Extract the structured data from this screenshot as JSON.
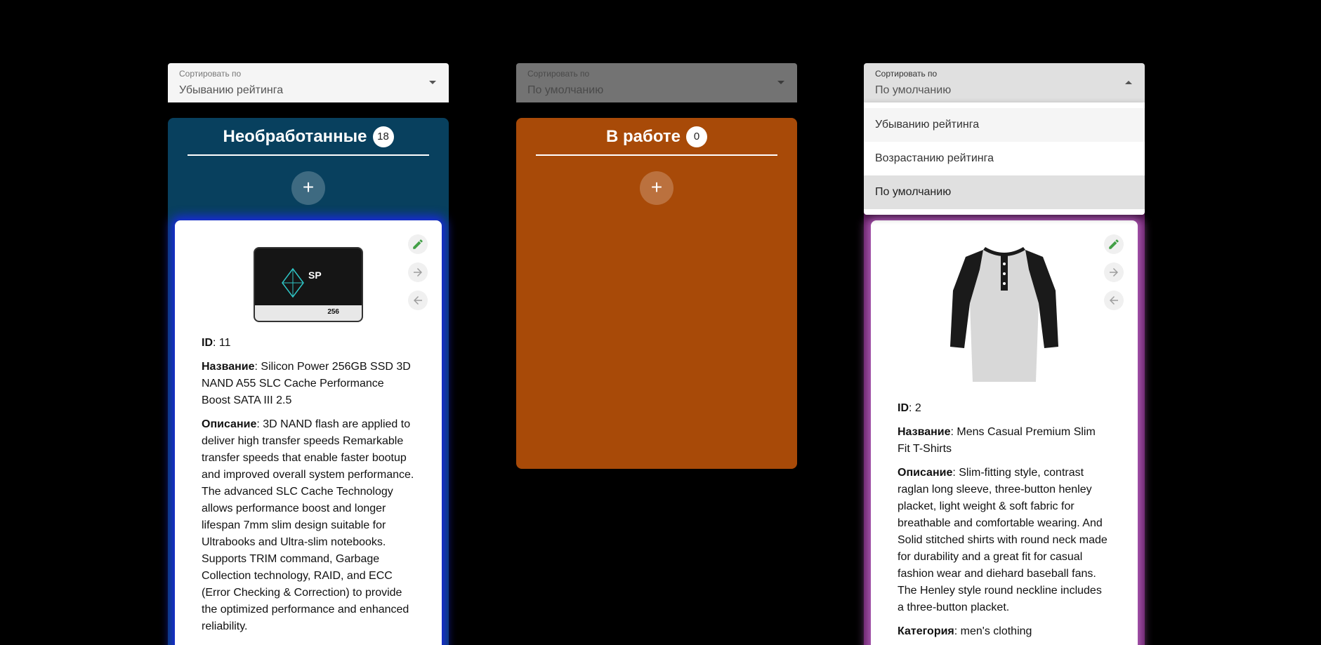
{
  "sort_label": "Сортировать по",
  "selects": [
    {
      "value": "Убыванию рейтинга"
    },
    {
      "value": "По умолчанию"
    },
    {
      "value": "По умолчанию"
    }
  ],
  "dropdown_options": [
    "Убыванию рейтинга",
    "Возрастанию рейтинга",
    "По умолчанию"
  ],
  "columns": [
    {
      "title": "Необработанные",
      "count": "18",
      "color": "#08405e"
    },
    {
      "title": "В работе",
      "count": "0",
      "color": "#a84a08"
    }
  ],
  "add_label": "+",
  "labels": {
    "id": "ID",
    "name": "Название",
    "description": "Описание",
    "category": "Категория"
  },
  "cards": [
    {
      "id": "11",
      "name": "Silicon Power 256GB SSD 3D NAND A55 SLC Cache Performance Boost SATA III 2.5",
      "description": "3D NAND flash are applied to deliver high transfer speeds Remarkable transfer speeds that enable faster bootup and improved overall system performance. The advanced SLC Cache Technology allows performance boost and longer lifespan 7mm slim design suitable for Ultrabooks and Ultra-slim notebooks. Supports TRIM command, Garbage Collection technology, RAID, and ECC (Error Checking & Correction) to provide the optimized performance and enhanced reliability.",
      "image_logo": "SP",
      "image_capacity": "256",
      "glow": "#1a2ae0"
    },
    {
      "id": "2",
      "name": "Mens Casual Premium Slim Fit T-Shirts",
      "description": "Slim-fitting style, contrast raglan long sleeve, three-button henley placket, light weight & soft fabric for breathable and comfortable wearing. And Solid stitched shirts with round neck made for durability and a great fit for casual fashion wear and diehard baseball fans. The Henley style round neckline includes a three-button placket.",
      "category": "men's clothing",
      "glow": "#b05cb8"
    }
  ],
  "colors": {
    "edit_icon": "#43a047",
    "arrow_icon": "#9e9e9e"
  }
}
